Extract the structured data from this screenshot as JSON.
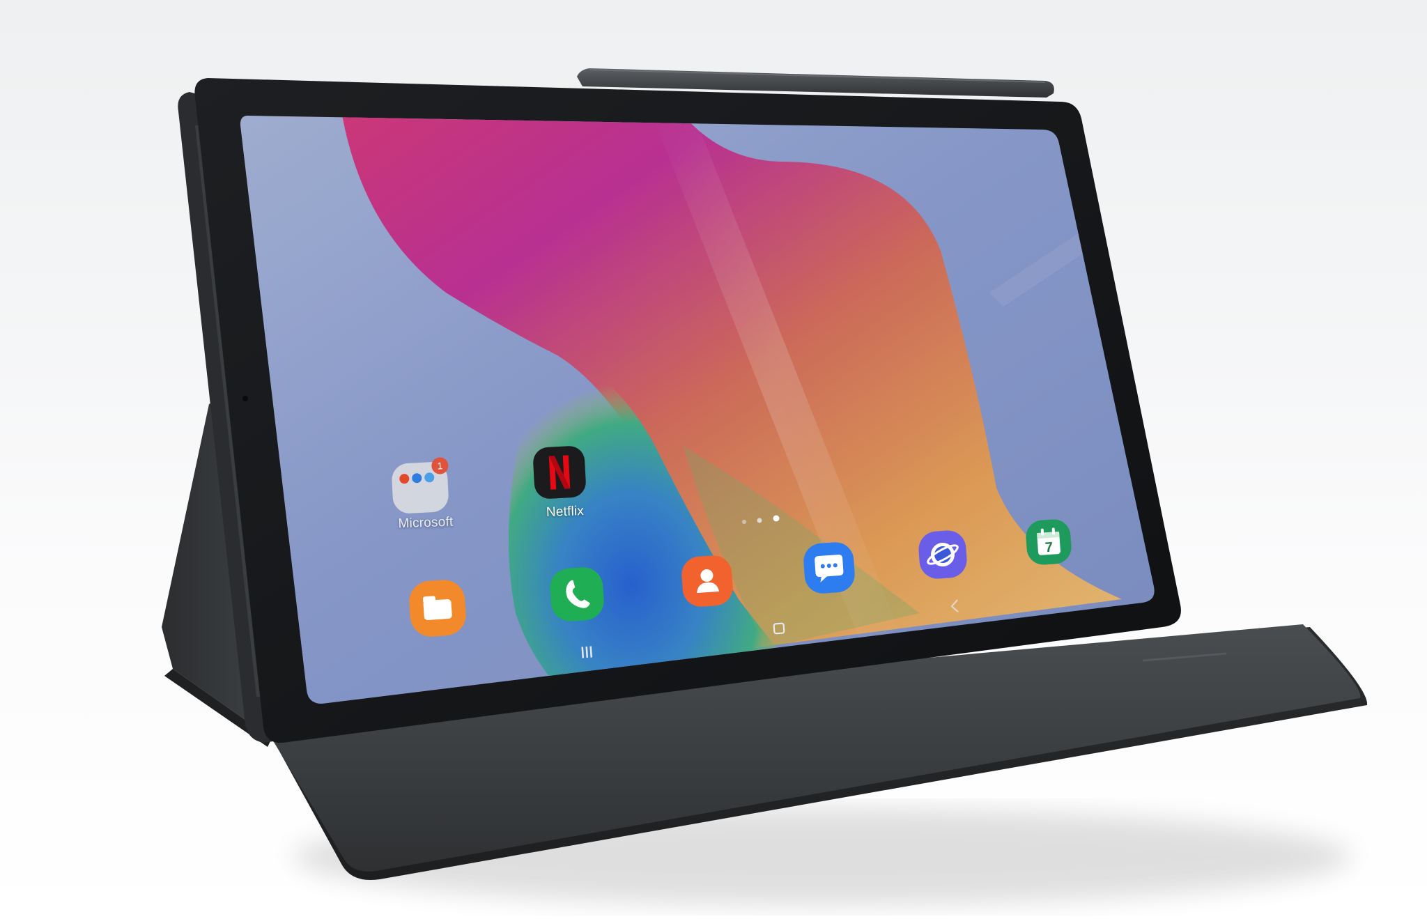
{
  "photo": {
    "subject": "tablet-on-folio-stand",
    "home_screen": {
      "folder": {
        "label": "Microsoft",
        "badge_count": "1"
      },
      "apps": [
        {
          "label": "Netflix",
          "icon": "netflix-icon"
        }
      ],
      "dock": [
        {
          "icon": "my-files-icon",
          "color": "#f28a2b"
        },
        {
          "icon": "phone-icon",
          "color": "#1fae53"
        },
        {
          "icon": "contacts-icon",
          "color": "#f2622e"
        },
        {
          "icon": "messages-icon",
          "color": "#2e7df0"
        },
        {
          "icon": "internet-icon",
          "color": "#6a5ee8"
        },
        {
          "icon": "calendar-icon",
          "color": "#1f9a5d",
          "day": "7"
        }
      ],
      "page_indicator": {
        "pages": 3,
        "current": 3
      },
      "nav_bar": [
        "recents-icon",
        "home-icon",
        "back-icon"
      ]
    },
    "colors": {
      "wallpaper_blue": "#8fa2d4",
      "wallpaper_magenta": "#c2339a",
      "wallpaper_orange": "#e7a25a",
      "bezel": "#141517",
      "folio": "#3b3d40"
    }
  }
}
